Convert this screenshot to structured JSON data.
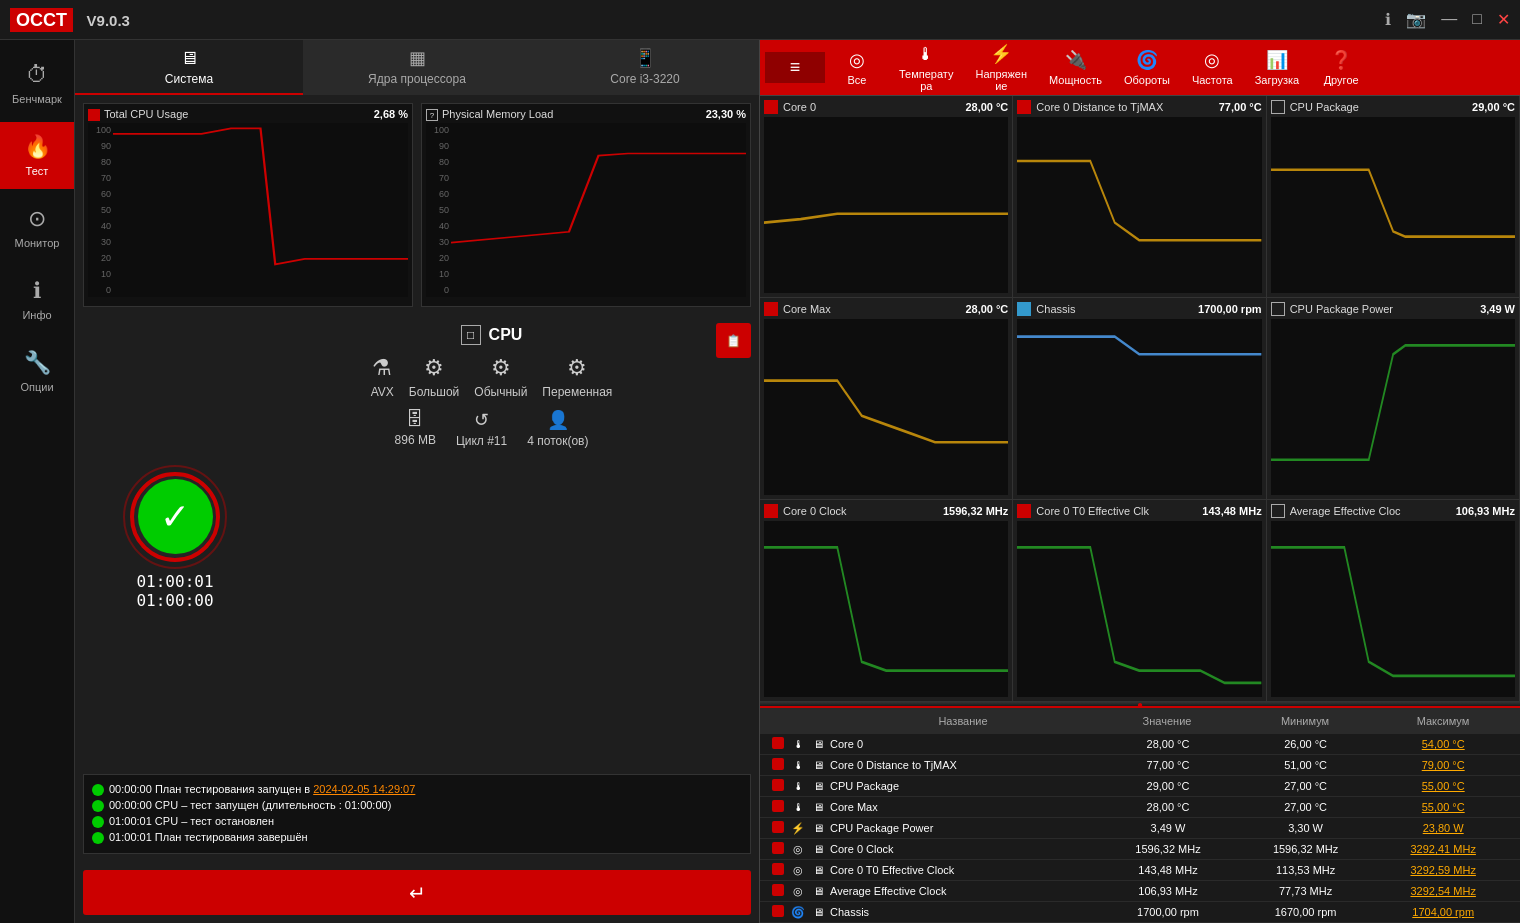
{
  "titlebar": {
    "logo": "OCCT",
    "version": "V9.0.3",
    "controls": [
      "ℹ",
      "📷",
      "—",
      "□",
      "✕"
    ]
  },
  "sidebar": {
    "items": [
      {
        "id": "benchmark",
        "icon": "⏱",
        "label": "Бенчмарк"
      },
      {
        "id": "test",
        "icon": "🔥",
        "label": "Тест",
        "active": true
      },
      {
        "id": "monitor",
        "icon": "⊙",
        "label": "Монитор"
      },
      {
        "id": "info",
        "icon": "ℹ",
        "label": "Инфо"
      },
      {
        "id": "options",
        "icon": "🔧",
        "label": "Опции"
      }
    ]
  },
  "tabs": [
    {
      "icon": "🖥",
      "label": "Система",
      "active": true
    },
    {
      "icon": "▦",
      "label": "Ядра процессора"
    },
    {
      "icon": "📱",
      "label": "Core i3-3220"
    }
  ],
  "cpu_chart": {
    "label": "Total CPU Usage",
    "value": "2,68 %"
  },
  "memory_chart": {
    "label": "Physical Memory Load",
    "value": "23,30 %"
  },
  "cpu_section": {
    "title": "CPU",
    "options": [
      {
        "icon": "⚗",
        "label": "AVX"
      },
      {
        "icon": "⚙",
        "label": "Большой"
      },
      {
        "icon": "⚙",
        "label": "Обычный"
      },
      {
        "icon": "⚙",
        "label": "Переменная"
      }
    ],
    "details": [
      {
        "icon": "🗄",
        "label": "896 MB"
      },
      {
        "icon": "↺",
        "label": "Цикл #11"
      },
      {
        "icon": "👤",
        "label": "4 поток(ов)"
      }
    ]
  },
  "timers": {
    "elapsed": "01:00:01",
    "total": "01:00:00"
  },
  "log": [
    {
      "dot": true,
      "time": "00:00:00",
      "text": "План тестирования запущен в ",
      "link": "2024-02-05 14:29:07"
    },
    {
      "dot": true,
      "time": "00:00:00",
      "text": "CPU – тест запущен (длительность : 01:00:00)"
    },
    {
      "dot": true,
      "time": "01:00:01",
      "text": "CPU – тест остановлен"
    },
    {
      "dot": true,
      "time": "01:00:01",
      "text": "План тестирования завершён"
    }
  ],
  "right_header": {
    "buttons": [
      {
        "icon": "≡",
        "label": "",
        "active": true
      },
      {
        "icon": "◎",
        "label": "Все",
        "active": false
      },
      {
        "icon": "🌡",
        "label": "Температу\nра"
      },
      {
        "icon": "⚡",
        "label": "Напряжен\nие"
      },
      {
        "icon": "⚡",
        "label": "Мощность"
      },
      {
        "icon": "🌀",
        "label": "Обороты"
      },
      {
        "icon": "◎",
        "label": "Частота"
      },
      {
        "icon": "📊",
        "label": "Загрузка"
      },
      {
        "icon": "❓",
        "label": "Другое"
      }
    ]
  },
  "monitor_cells": [
    {
      "name": "Core 0",
      "value": "28,00 °C",
      "icon_type": "red",
      "chart_color": "#b8860b",
      "y_max": 40,
      "y_labels": [
        "40",
        "",
        "",
        "",
        "0"
      ]
    },
    {
      "name": "Core 0 Distance to TjMAX",
      "value": "77,00 °C",
      "icon_type": "red",
      "chart_color": "#b8860b",
      "y_max": 80,
      "y_labels": [
        "80",
        "60",
        "40",
        "20",
        "0"
      ]
    },
    {
      "name": "CPU Package",
      "value": "29,00 °C",
      "icon_type": "outline",
      "chart_color": "#b8860b",
      "y_max": 60,
      "y_labels": [
        "60",
        "40",
        "20",
        "0"
      ]
    },
    {
      "name": "Core Max",
      "value": "28,00 °C",
      "icon_type": "red",
      "chart_color": "#b8860b",
      "y_max": 60,
      "y_labels": [
        "60",
        "40",
        "20",
        "0"
      ]
    },
    {
      "name": "Chassis",
      "value": "1700,00 rpm",
      "icon_type": "blue",
      "chart_color": "#4488cc",
      "y_max": 1500,
      "y_labels": [
        "1500",
        "1000",
        "500",
        "0"
      ]
    },
    {
      "name": "CPU Package Power",
      "value": "3,49 W",
      "icon_type": "outline",
      "chart_color": "#228822",
      "y_max": 20,
      "y_labels": [
        "20",
        "10",
        "0"
      ]
    },
    {
      "name": "Core 0 Clock",
      "value": "1596,32 MHz",
      "icon_type": "red",
      "chart_color": "#228822",
      "y_max": 3000,
      "y_labels": [
        "3000",
        "2000",
        "1000",
        "0"
      ]
    },
    {
      "name": "Core 0 T0 Effective Clk",
      "value": "143,48 MHz",
      "icon_type": "red",
      "chart_color": "#228822",
      "y_max": 3000,
      "y_labels": [
        "3000",
        "2000",
        "1000",
        "0"
      ]
    },
    {
      "name": "Average Effective Cloc",
      "value": "106,93 MHz",
      "icon_type": "outline",
      "chart_color": "#228822",
      "y_max": 3000,
      "y_labels": [
        "3000",
        "2000",
        "1000",
        "0"
      ]
    }
  ],
  "table": {
    "headers": [
      "",
      "",
      "",
      "Название",
      "Значение",
      "Минимум",
      "Максимум"
    ],
    "rows": [
      {
        "name": "Core 0",
        "value": "28,00 °C",
        "min": "26,00 °C",
        "max": "54,00 °C",
        "max_highlight": true,
        "icon": "🌡"
      },
      {
        "name": "Core 0 Distance to TjMAX",
        "value": "77,00 °C",
        "min": "51,00 °C",
        "max": "79,00 °C",
        "max_highlight": true,
        "icon": "🌡"
      },
      {
        "name": "CPU Package",
        "value": "29,00 °C",
        "min": "27,00 °C",
        "max": "55,00 °C",
        "max_highlight": true,
        "icon": "🌡"
      },
      {
        "name": "Core Max",
        "value": "28,00 °C",
        "min": "27,00 °C",
        "max": "55,00 °C",
        "max_highlight": true,
        "icon": "🌡"
      },
      {
        "name": "CPU Package Power",
        "value": "3,49 W",
        "min": "3,30 W",
        "max": "23,80 W",
        "max_highlight": true,
        "icon": "⚡"
      },
      {
        "name": "Core 0 Clock",
        "value": "1596,32 MHz",
        "min": "1596,32 MHz",
        "max": "3292,41 MHz",
        "max_highlight": true,
        "icon": "◎"
      },
      {
        "name": "Core 0 T0 Effective Clock",
        "value": "143,48 MHz",
        "min": "113,53 MHz",
        "max": "3292,59 MHz",
        "max_highlight": true,
        "icon": "◎"
      },
      {
        "name": "Average Effective Clock",
        "value": "106,93 MHz",
        "min": "77,73 MHz",
        "max": "3292,54 MHz",
        "max_highlight": true,
        "icon": "◎"
      },
      {
        "name": "Chassis",
        "value": "1700,00 rpm",
        "min": "1670,00 rpm",
        "max": "1704,00 rpm",
        "max_highlight": true,
        "icon": "🌀"
      }
    ]
  }
}
